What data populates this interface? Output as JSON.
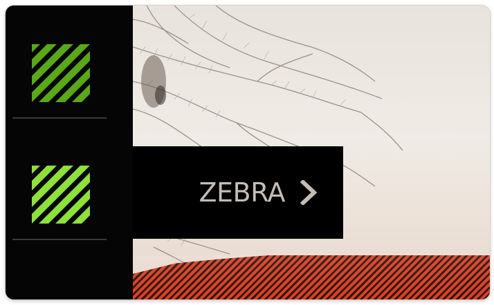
{
  "zebra_menu": {
    "label": "ZEBRA",
    "chevron": "chevron-right-icon"
  },
  "rail": {
    "icons": [
      {
        "name": "zebra-stripes-icon",
        "color": "#5aa817"
      },
      {
        "name": "zebra-stripes-icon",
        "color": "#8ee03b"
      }
    ]
  },
  "overlay": {
    "zebra_color": "#d83a1e"
  }
}
